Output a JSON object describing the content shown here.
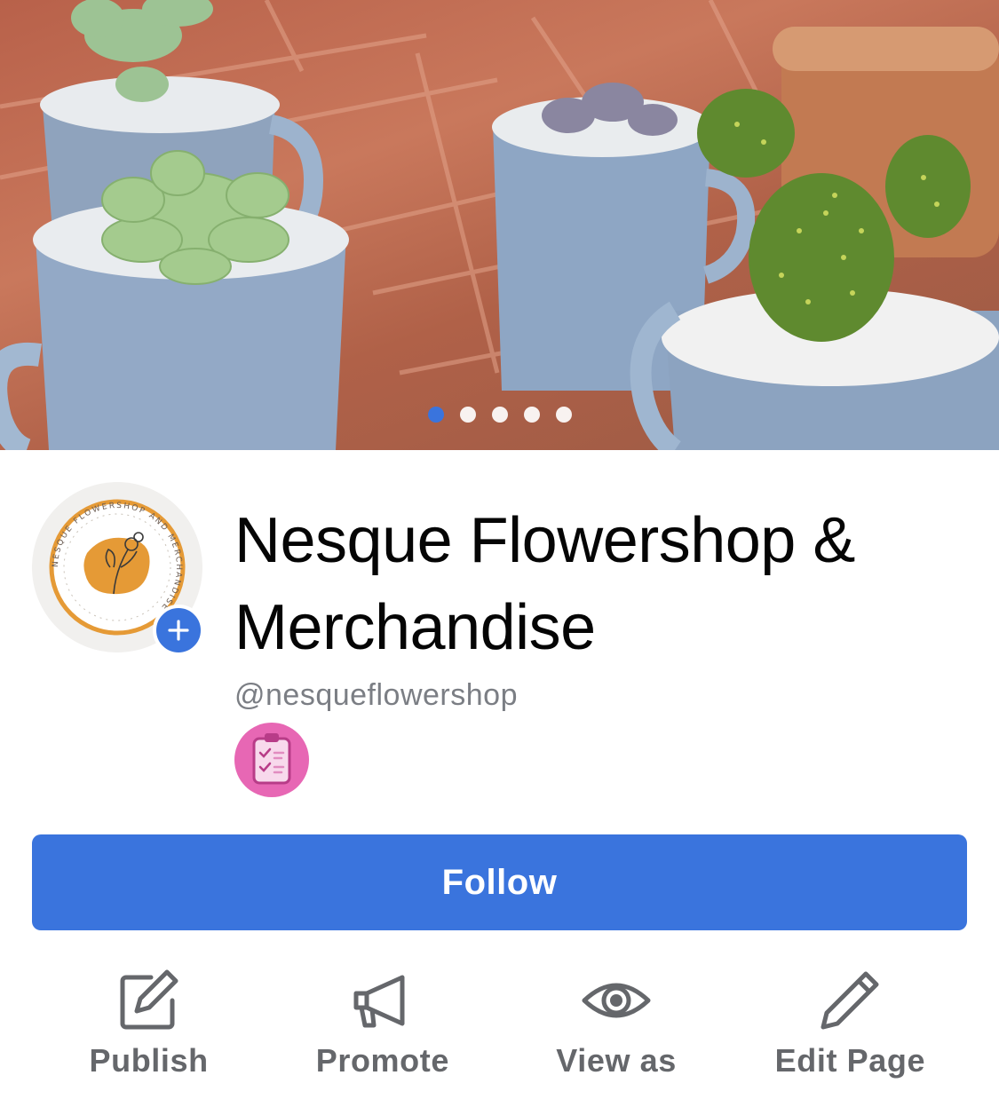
{
  "cover": {
    "carousel_total": 5,
    "carousel_active": 1
  },
  "profile": {
    "name": "Nesque Flowershop & Merchandise",
    "handle": "@nesqueflowershop",
    "logo_text": "NESQUE FLOWERSHOP AND MERCHANDISE"
  },
  "primary_button": {
    "label": "Follow"
  },
  "actions": [
    {
      "label": "Publish",
      "icon": "compose-icon"
    },
    {
      "label": "Promote",
      "icon": "megaphone-icon"
    },
    {
      "label": "View as",
      "icon": "eye-icon"
    },
    {
      "label": "Edit Page",
      "icon": "pencil-icon"
    }
  ],
  "colors": {
    "accent": "#3a74dd",
    "badge": "#e767b4",
    "muted": "#65676b"
  }
}
